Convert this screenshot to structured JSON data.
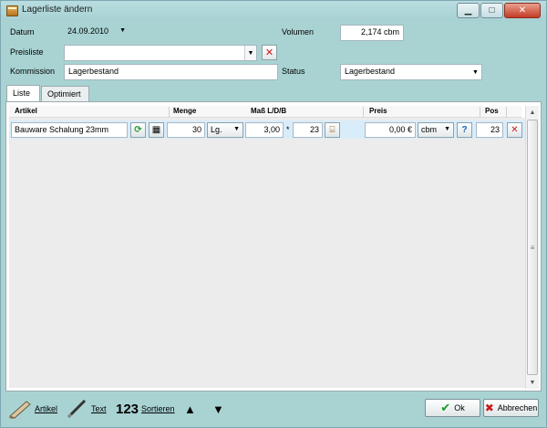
{
  "window": {
    "title": "Lagerliste ändern"
  },
  "form": {
    "datum_label": "Datum",
    "datum_value": "24.09.2010",
    "volumen_label": "Volumen",
    "volumen_value": "2,174 cbm",
    "preisliste_label": "Preisliste",
    "preisliste_value": "",
    "kommission_label": "Kommission",
    "kommission_value": "Lagerbestand",
    "status_label": "Status",
    "status_value": "Lagerbestand"
  },
  "tabs": [
    {
      "label": "Liste",
      "active": true
    },
    {
      "label": "Optimiert",
      "active": false
    }
  ],
  "grid": {
    "headers": {
      "artikel": "Artikel",
      "menge": "Menge",
      "mass": "Maß L/D/B",
      "preis": "Preis",
      "pos": "Pos"
    },
    "rows": [
      {
        "artikel": "Bauware Schalung 23mm",
        "menge": "30",
        "unit": "Lg.",
        "laenge": "3,00",
        "times": "*",
        "breite": "23",
        "preis": "0,00 €",
        "preis_unit": "cbm",
        "pos": "23"
      }
    ]
  },
  "toolbar": {
    "artikel_label": "Artikel",
    "text_label": "Text",
    "sort_digits": "123",
    "sort_label": "Sortieren"
  },
  "buttons": {
    "ok_label": "Ok",
    "cancel_label": "Abbrechen"
  },
  "colors": {
    "background": "#a9d3d3",
    "row_highlight": "#d9ecfa",
    "ok_green": "#1d9a25",
    "cancel_red": "#c71b1b"
  }
}
